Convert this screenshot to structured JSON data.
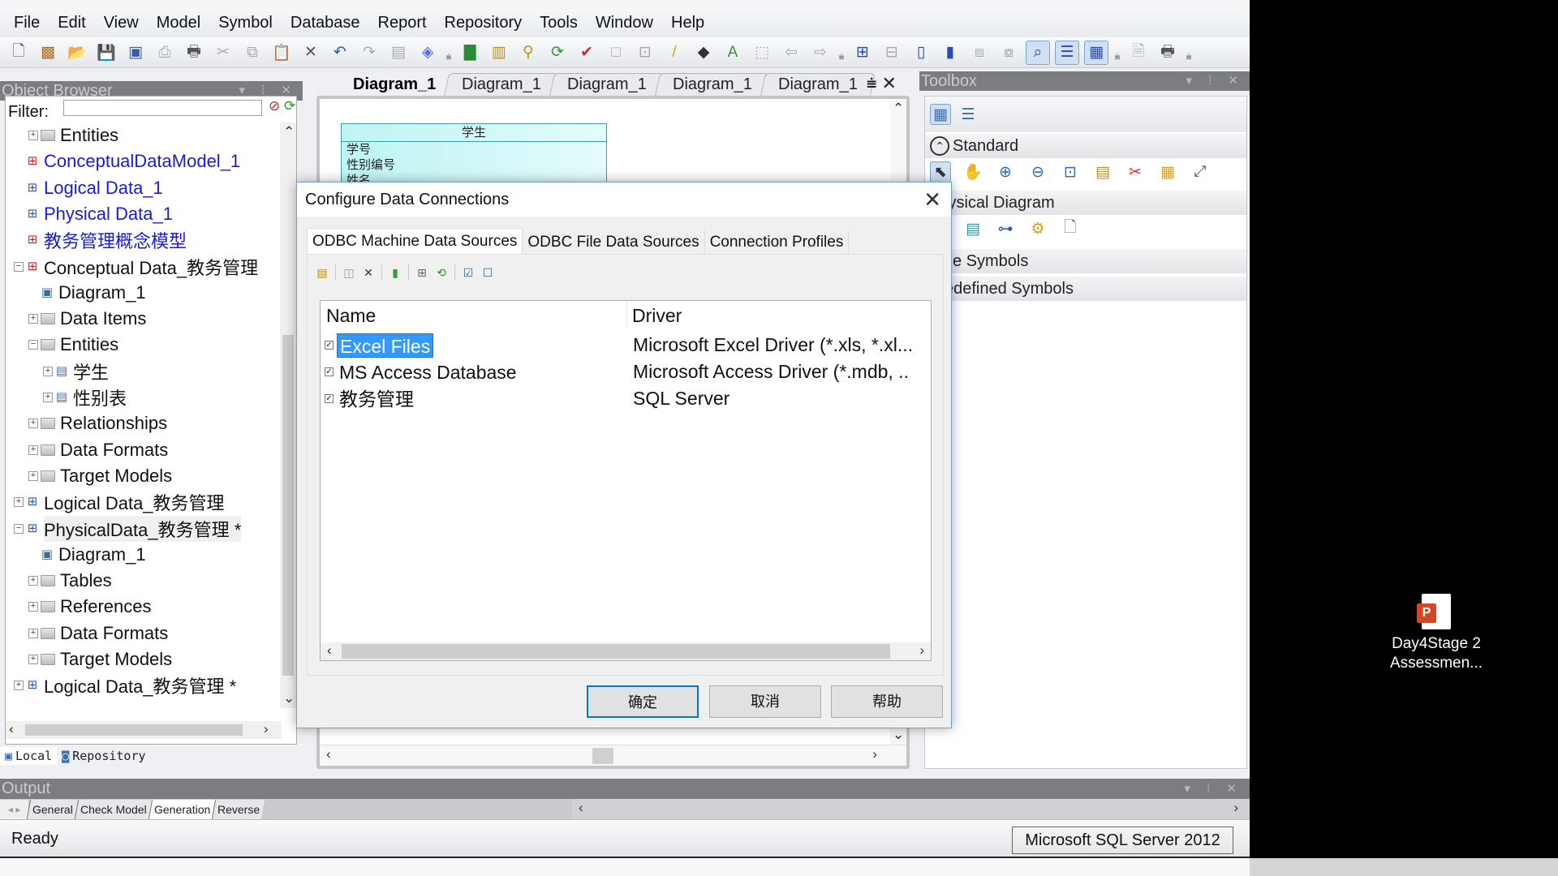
{
  "menu": [
    "File",
    "Edit",
    "View",
    "Model",
    "Symbol",
    "Database",
    "Report",
    "Repository",
    "Tools",
    "Window",
    "Help"
  ],
  "toolbar_icons": [
    "new-icon",
    "new-project-icon",
    "open-icon",
    "save-icon",
    "save-all-icon",
    "print-preview-icon",
    "print-icon",
    "cut-icon",
    "copy-icon",
    "paste-icon",
    "delete-icon",
    "undo-icon",
    "redo-icon",
    "properties-icon",
    "help-icon",
    "new-model-icon",
    "import-icon",
    "find-icon",
    "refresh-icon",
    "check-model-icon",
    "shadow-icon",
    "align-icon",
    "line-style-icon",
    "fill-icon",
    "font-icon",
    "bring-front-icon",
    "back-icon",
    "forward-icon",
    "diagram-view-icon",
    "grid-icon",
    "page-icon",
    "page-multi-icon",
    "layout-icon",
    "layout2-icon",
    "browser-view-icon",
    "output-view-icon",
    "result-list-icon",
    "preview-icon",
    "print2-icon"
  ],
  "object_browser": {
    "title": "Object Browser",
    "filter_label": "Filter:",
    "filter_value": "",
    "tree": [
      {
        "label": "Entities",
        "level": 1,
        "expander": "+",
        "icon": "folder",
        "color": "black"
      },
      {
        "label": "ConceptualDataModel_1",
        "level": 0,
        "expander": "",
        "icon": "cdm",
        "color": "blue"
      },
      {
        "label": "Logical Data_1",
        "level": 0,
        "expander": "",
        "icon": "ldm",
        "color": "blue"
      },
      {
        "label": "Physical Data_1",
        "level": 0,
        "expander": "",
        "icon": "pdm",
        "color": "blue"
      },
      {
        "label": "教务管理概念模型",
        "level": 0,
        "expander": "",
        "icon": "cdm",
        "color": "blue"
      },
      {
        "label": "Conceptual Data_教务管理",
        "level": 0,
        "expander": "-",
        "icon": "cdm",
        "color": "black"
      },
      {
        "label": "Diagram_1",
        "level": 1,
        "expander": "",
        "icon": "diagram",
        "color": "black"
      },
      {
        "label": "Data Items",
        "level": 1,
        "expander": "+",
        "icon": "folder",
        "color": "black"
      },
      {
        "label": "Entities",
        "level": 1,
        "expander": "-",
        "icon": "folder",
        "color": "black"
      },
      {
        "label": "学生",
        "level": 2,
        "expander": "+",
        "icon": "entity",
        "color": "black"
      },
      {
        "label": "性别表",
        "level": 2,
        "expander": "+",
        "icon": "entity",
        "color": "black"
      },
      {
        "label": "Relationships",
        "level": 1,
        "expander": "+",
        "icon": "folder",
        "color": "black"
      },
      {
        "label": "Data Formats",
        "level": 1,
        "expander": "+",
        "icon": "folder",
        "color": "black"
      },
      {
        "label": "Target Models",
        "level": 1,
        "expander": "+",
        "icon": "folder",
        "color": "black"
      },
      {
        "label": "Logical Data_教务管理",
        "level": 0,
        "expander": "+",
        "icon": "ldm",
        "color": "black"
      },
      {
        "label": "PhysicalData_教务管理 *",
        "level": 0,
        "expander": "-",
        "icon": "ldm",
        "color": "black"
      },
      {
        "label": "Diagram_1",
        "level": 1,
        "expander": "",
        "icon": "diagram",
        "color": "black"
      },
      {
        "label": "Tables",
        "level": 1,
        "expander": "+",
        "icon": "folder",
        "color": "black"
      },
      {
        "label": "References",
        "level": 1,
        "expander": "+",
        "icon": "folder",
        "color": "black"
      },
      {
        "label": "Data Formats",
        "level": 1,
        "expander": "+",
        "icon": "folder",
        "color": "black"
      },
      {
        "label": "Target Models",
        "level": 1,
        "expander": "+",
        "icon": "folder",
        "color": "black"
      },
      {
        "label": "Logical Data_教务管理 *",
        "level": 0,
        "expander": "+",
        "icon": "ldm",
        "color": "black"
      }
    ],
    "tabs": [
      {
        "label": "Local",
        "active": true
      },
      {
        "label": "Repository",
        "active": false
      }
    ]
  },
  "diagram": {
    "tabs": [
      "Diagram_1",
      "Diagram_1",
      "Diagram_1",
      "Diagram_1",
      "Diagram_1"
    ],
    "active_tab": 0,
    "entity": {
      "name": "学生",
      "attributes": [
        "学号",
        "性别编号",
        "姓名"
      ]
    }
  },
  "toolbox": {
    "title": "Toolbox",
    "sections": [
      {
        "label": "Standard",
        "tools": [
          "pointer-icon",
          "hand-icon",
          "zoom-in-icon",
          "zoom-out-icon",
          "zoom-fit-icon",
          "properties-icon",
          "cut-icon",
          "format-icon",
          "link-icon"
        ]
      },
      {
        "label": "Physical Diagram",
        "tools": [
          "table-icon",
          "view-icon",
          "reference-icon",
          "procedure-icon",
          "file-icon"
        ]
      },
      {
        "label": "Free Symbols",
        "tools": []
      },
      {
        "label": "Predefined Symbols",
        "tools": []
      }
    ]
  },
  "dialog": {
    "title": "Configure Data Connections",
    "tabs": [
      "ODBC Machine Data Sources",
      "ODBC File Data Sources",
      "Connection Profiles"
    ],
    "active_tab": 0,
    "columns": [
      "Name",
      "Driver"
    ],
    "rows": [
      {
        "name": "Excel Files",
        "driver": "Microsoft Excel Driver (*.xls, *.xl...",
        "checked": true,
        "selected": true
      },
      {
        "name": "MS Access Database",
        "driver": "Microsoft Access Driver (*.mdb, ..",
        "checked": true,
        "selected": false
      },
      {
        "name": "教务管理",
        "driver": "SQL Server",
        "checked": true,
        "selected": false
      }
    ],
    "buttons": {
      "ok": "确定",
      "cancel": "取消",
      "help": "帮助"
    }
  },
  "output": {
    "title": "Output",
    "tabs": [
      "General",
      "Check Model",
      "Generation",
      "Reverse"
    ],
    "active_tab": 2
  },
  "status": {
    "text": "Ready",
    "dbms": "Microsoft SQL Server 2012"
  },
  "desktop": {
    "icon_label_1": "Day4Stage 2",
    "icon_label_2": "Assessmen..."
  },
  "colors": {
    "selection": "#3399ff",
    "panel_header": "#7b7d80",
    "link_blue": "#1a1adc",
    "dialog_accent": "#0078d7"
  }
}
